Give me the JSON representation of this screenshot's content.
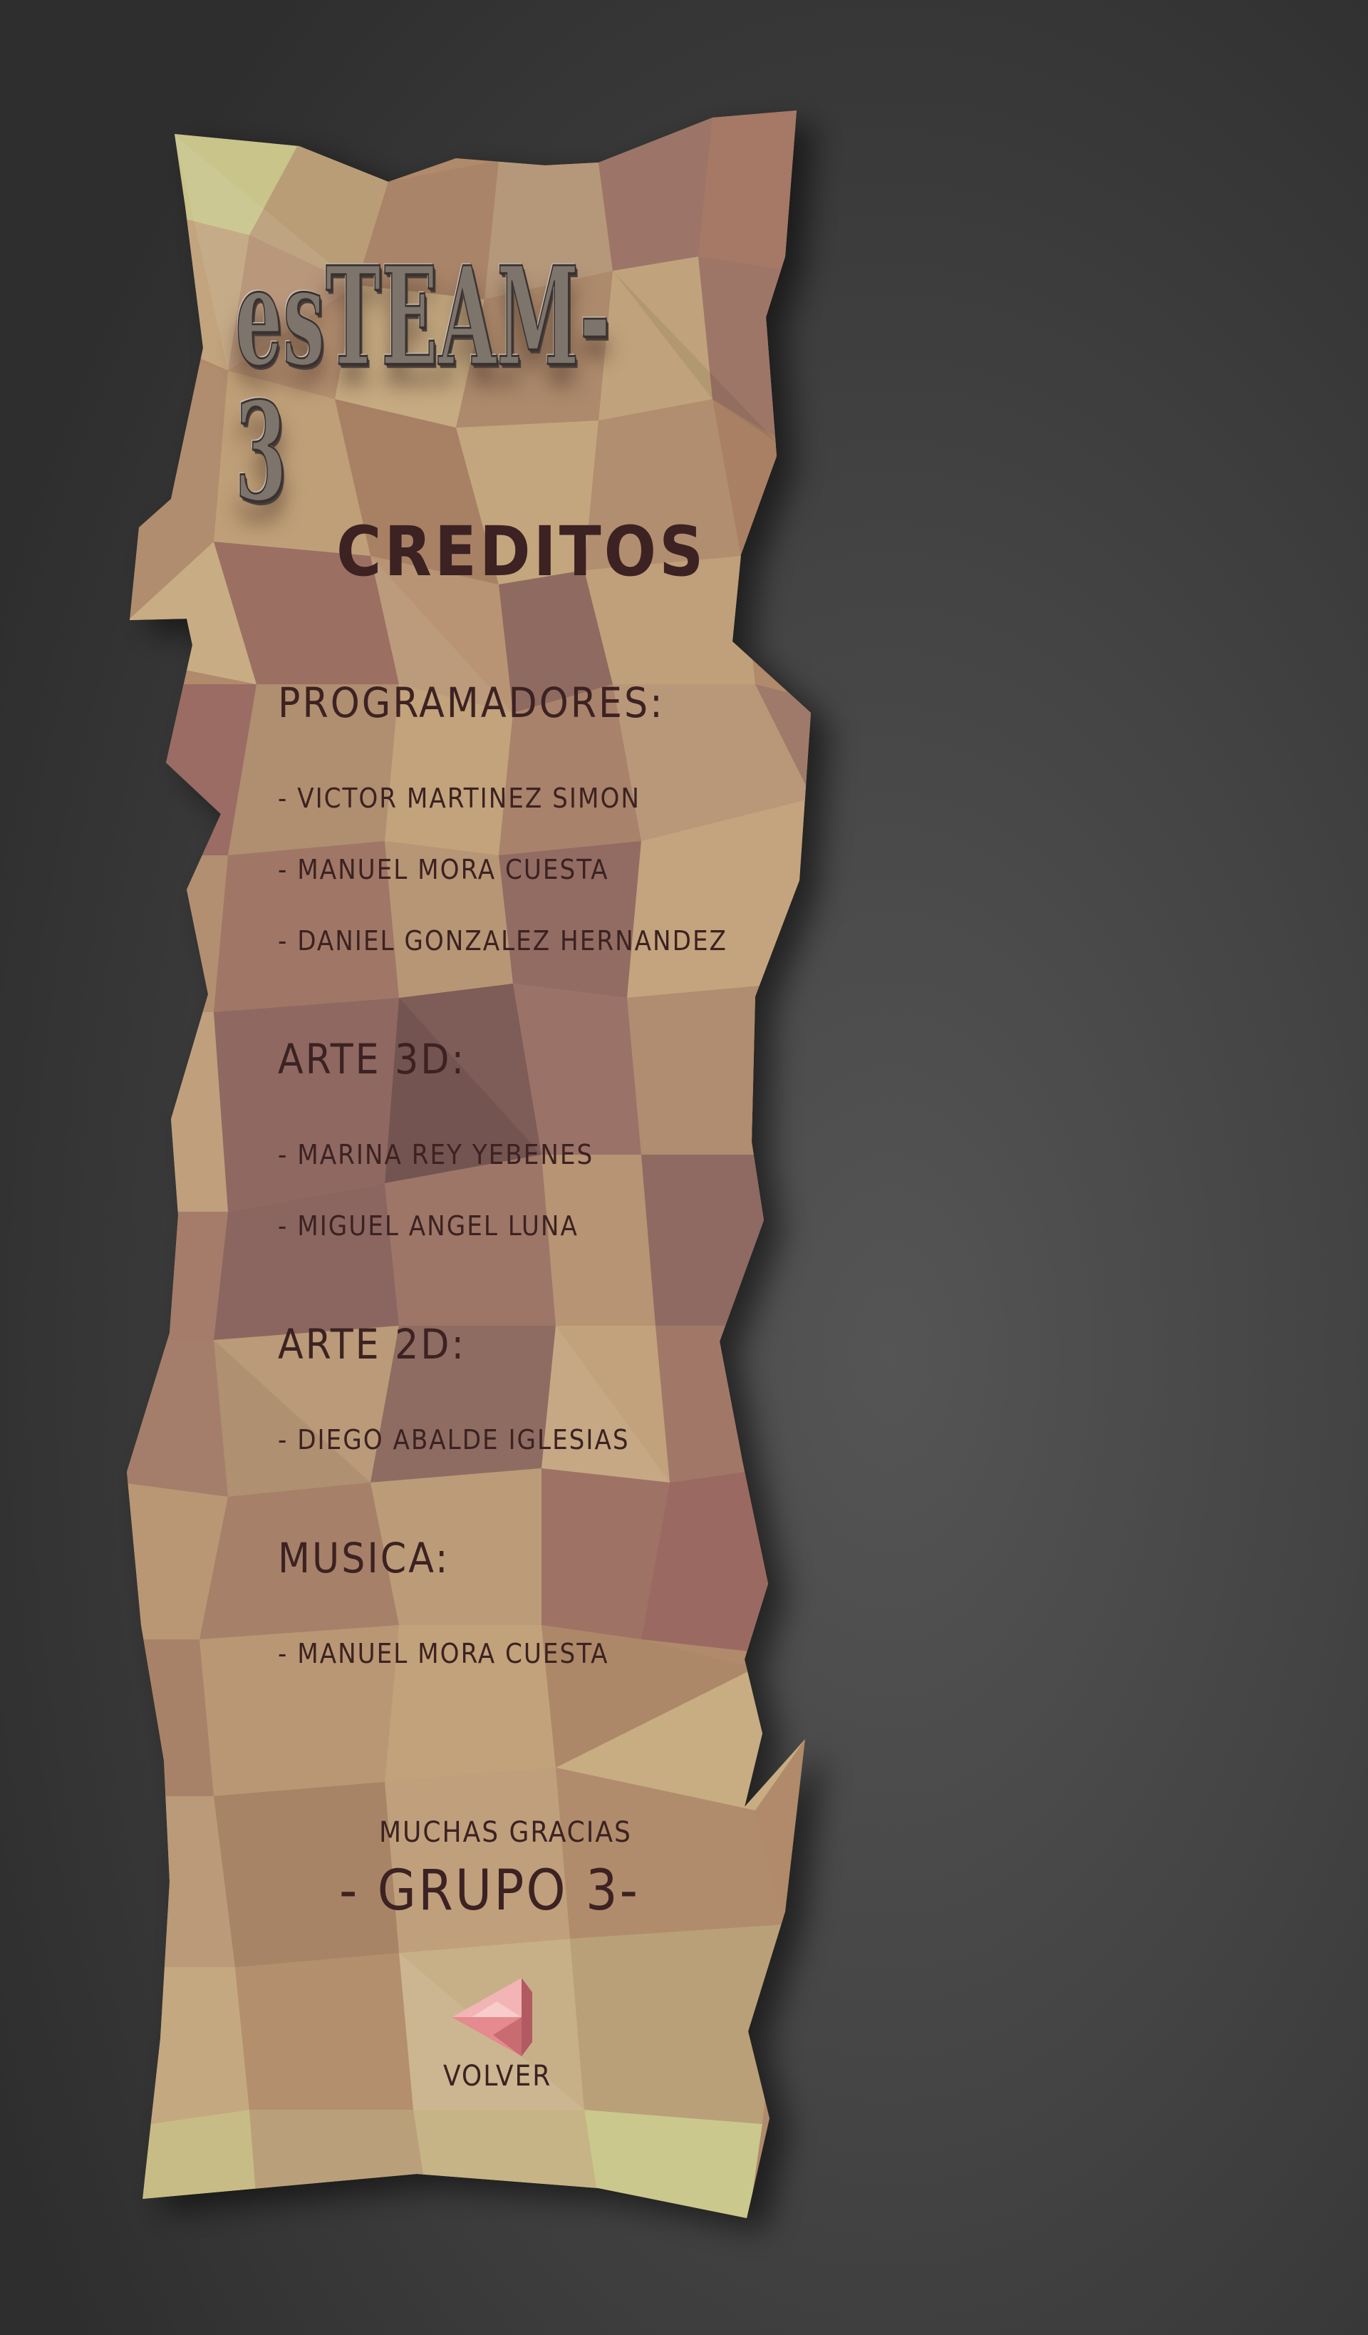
{
  "logo": {
    "text": "esTEAM-3"
  },
  "page": {
    "title": "CREDITOS"
  },
  "sections": [
    {
      "heading": "PROGRAMADORES:",
      "members": [
        "- VICTOR MARTINEZ SIMON",
        "- MANUEL MORA CUESTA",
        "- DANIEL GONZALEZ HERNANDEZ"
      ]
    },
    {
      "heading": "ARTE 3D:",
      "members": [
        "- MARINA REY YEBENES",
        "- MIGUEL ANGEL LUNA"
      ]
    },
    {
      "heading": "ARTE 2D:",
      "members": [
        "- DIEGO ABALDE IGLESIAS"
      ]
    },
    {
      "heading": "MUSICA:",
      "members": [
        "- MANUEL MORA CUESTA"
      ]
    }
  ],
  "footer": {
    "thanks": "MUCHAS GRACIAS",
    "group": "- GRUPO 3-"
  },
  "back_button": {
    "label": "VOLVER",
    "icon": "back-arrow-icon"
  },
  "colors": {
    "text": "#3c2222",
    "paper_light": "#c4a87e",
    "paper_dark": "#8c6a5c",
    "paper_yellow": "#c8c48a",
    "button_pink": "#e58a8e"
  }
}
